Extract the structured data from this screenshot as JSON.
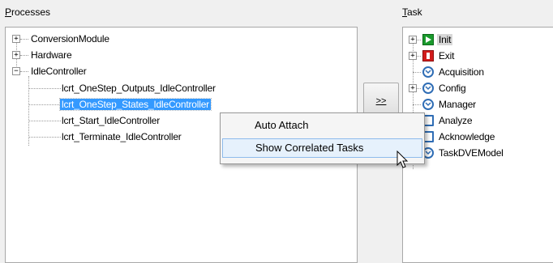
{
  "processes": {
    "label": "Processes",
    "label_rest": "rocesses",
    "label_key": "P",
    "items": [
      {
        "label": "ConversionModule"
      },
      {
        "label": "Hardware"
      },
      {
        "label": "IdleController"
      }
    ],
    "children": [
      {
        "label": "lcrt_OneStep_Outputs_IdleController"
      },
      {
        "label": "lcrt_OneStep_States_IdleController"
      },
      {
        "label": "lcrt_Start_IdleController"
      },
      {
        "label": "lcrt_Terminate_IdleController"
      }
    ]
  },
  "transfer_button": {
    "label": ">>"
  },
  "task": {
    "label_key": "T",
    "label_rest": "ask",
    "items": [
      {
        "label": "Init",
        "icon": "play-icon"
      },
      {
        "label": "Exit",
        "icon": "stop-icon"
      },
      {
        "label": "Acquisition",
        "icon": "clock-icon"
      },
      {
        "label": "Config",
        "icon": "clock-icon"
      },
      {
        "label": "Manager",
        "icon": "clock-icon"
      },
      {
        "label": "Analyze",
        "icon": "box-icon"
      },
      {
        "label": "Acknowledge",
        "icon": "box-icon"
      },
      {
        "label": "TaskDVEModel",
        "icon": "clock-icon"
      }
    ]
  },
  "context_menu": {
    "items": [
      {
        "label": "Auto Attach"
      },
      {
        "label": "Show Correlated Tasks"
      }
    ]
  },
  "colors": {
    "selection": "#3399ff",
    "hover": "#e6f1fc"
  }
}
